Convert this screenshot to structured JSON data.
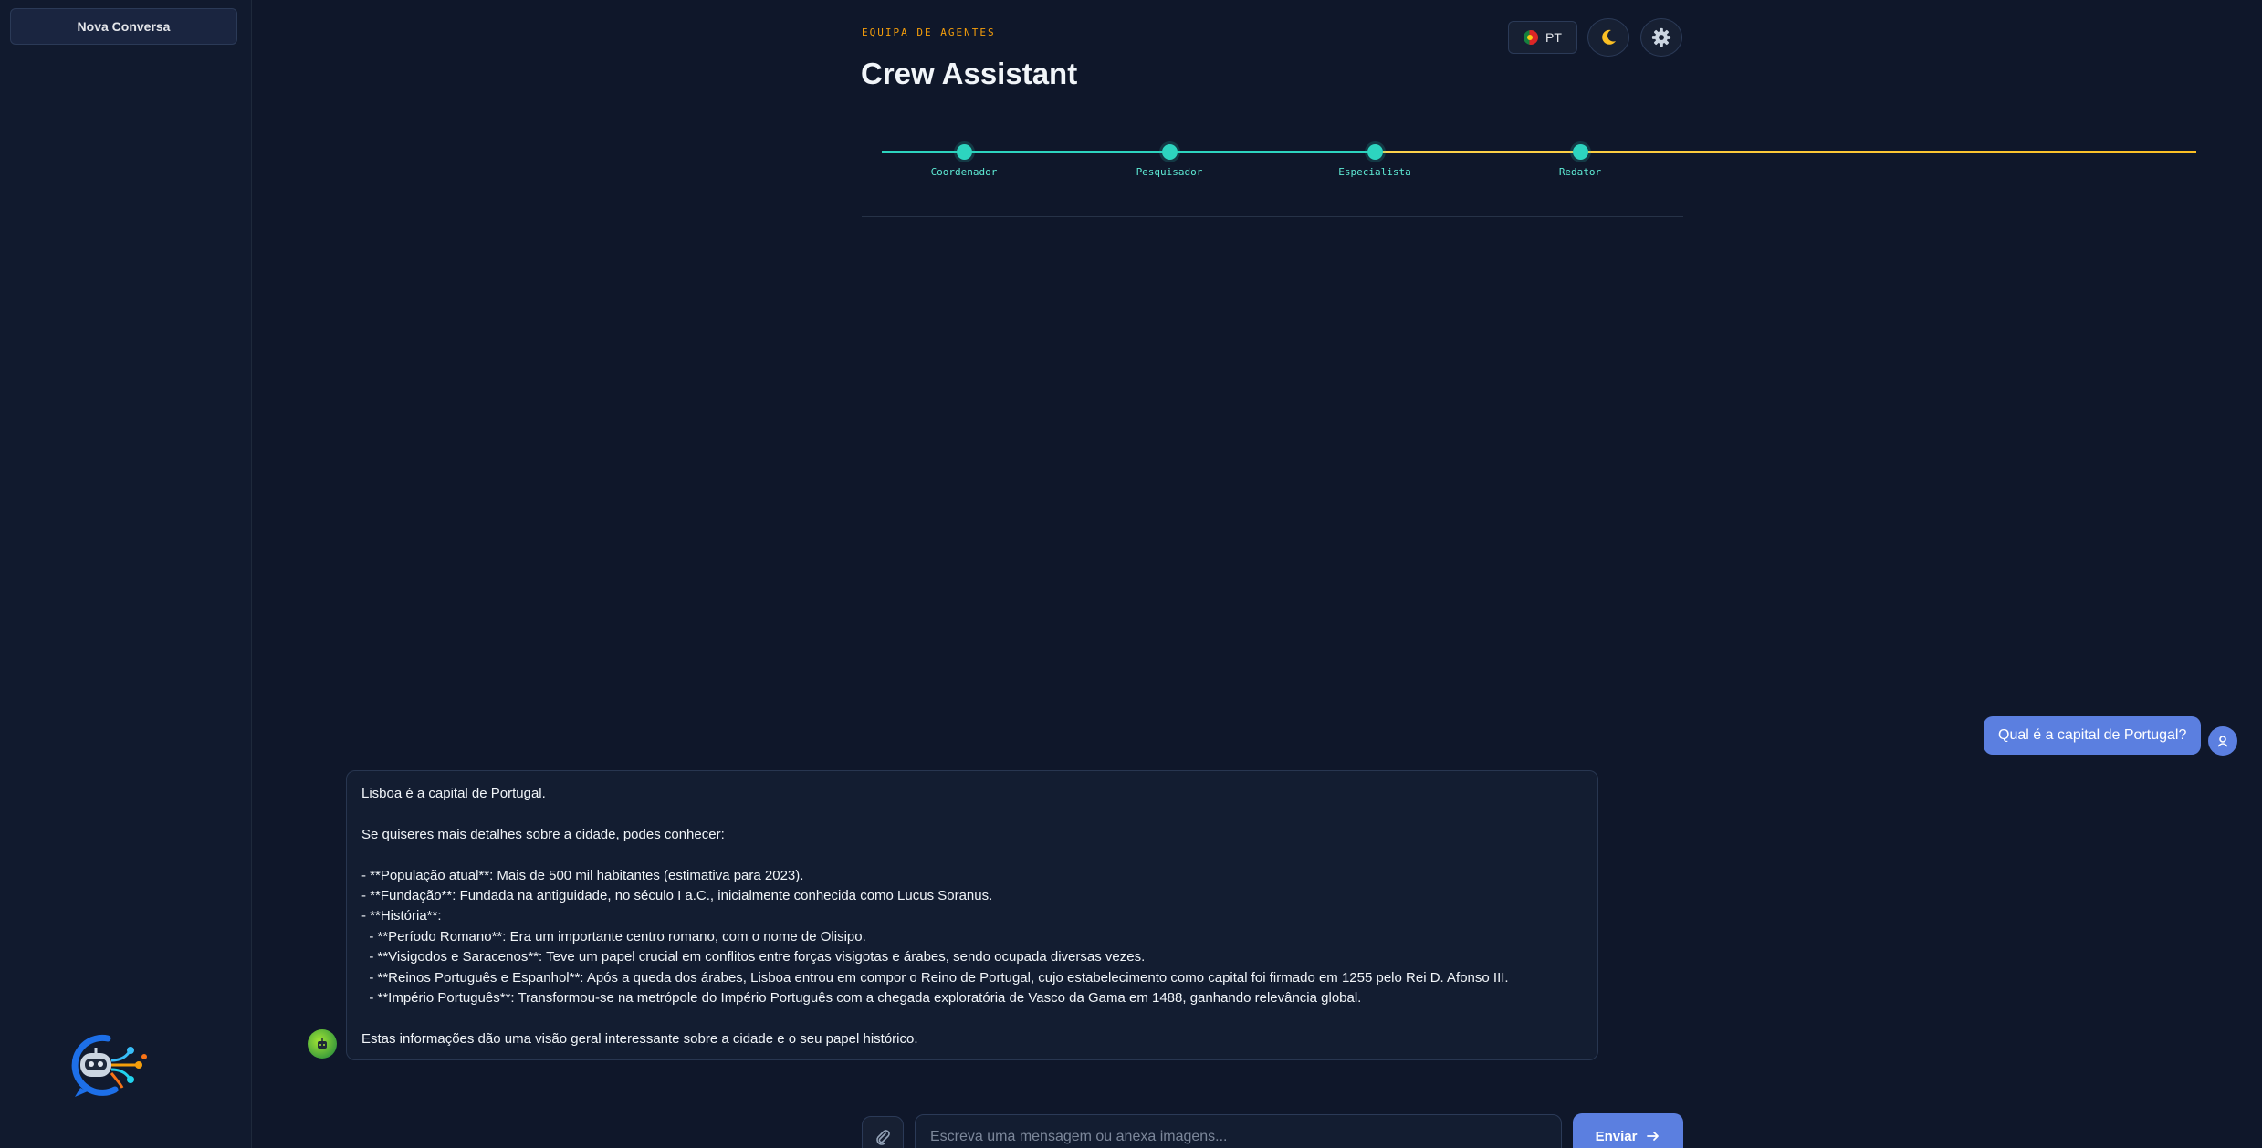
{
  "sidebar": {
    "new_chat_label": "Nova Conversa",
    "logo_icon": "robot-chat-logo-icon"
  },
  "header": {
    "eyebrow": "EQUIPA DE AGENTES",
    "title": "Crew Assistant",
    "language_label": "PT",
    "language_flag_icon": "portugal-flag-icon",
    "theme_icon": "moon-icon",
    "settings_icon": "gear-icon"
  },
  "pipeline": {
    "agents": [
      {
        "label": "Coordenador"
      },
      {
        "label": "Pesquisador"
      },
      {
        "label": "Especialista"
      },
      {
        "label": "Redator"
      }
    ],
    "colors": {
      "active": "#2dd4bf",
      "pending": "#fbbf24"
    }
  },
  "conversation": {
    "user_message": "Qual é a capital de Portugal?",
    "assistant_lines": [
      "Lisboa é a capital de Portugal.",
      "",
      "Se quiseres mais detalhes sobre a cidade, podes conhecer:",
      "",
      "- **População atual**: Mais de 500 mil habitantes (estimativa para 2023).",
      "- **Fundação**: Fundada na antiguidade, no século I a.C., inicialmente conhecida como Lucus Soranus.",
      "- **História**:",
      "  - **Período Romano**: Era um importante centro romano, com o nome de Olisipo.",
      "  - **Visigodos e Saracenos**: Teve um papel crucial em conflitos entre forças visigotas e árabes, sendo ocupada diversas vezes.",
      "  - **Reinos Português e Espanhol**: Após a queda dos árabes, Lisboa entrou em compor o Reino de Portugal, cujo estabelecimento como capital foi firmado em 1255 pelo Rei D. Afonso III.",
      "  - **Império Português**: Transformou-se na metrópole do Império Português com a chegada exploratória de Vasco da Gama em 1488, ganhando relevância global.",
      "",
      "Estas informações dão uma visão geral interessante sobre a cidade e o seu papel histórico."
    ]
  },
  "composer": {
    "input_value": "",
    "placeholder": "Escreva uma mensagem ou anexa imagens...",
    "send_label": "Enviar",
    "attach_icon": "paperclip-icon",
    "send_icon": "arrow-right-icon"
  },
  "colors": {
    "background": "#0f172a",
    "accent": "#5b7fe0",
    "eyebrow": "#f59e0b"
  }
}
